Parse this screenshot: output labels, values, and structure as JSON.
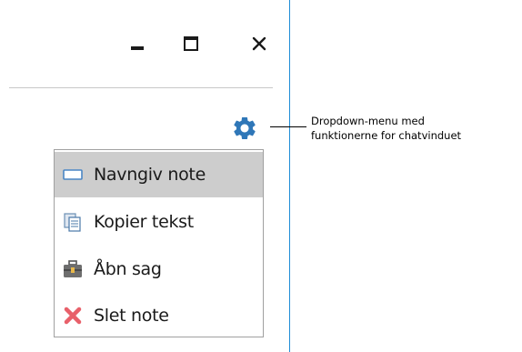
{
  "window_controls": {
    "minimize_icon": "minimize-icon",
    "maximize_icon": "maximize-icon",
    "close_icon": "close-icon"
  },
  "settings": {
    "icon": "gear-icon",
    "color": "#2f77b8"
  },
  "menu": {
    "items": [
      {
        "label": "Navngiv note",
        "icon": "rename-icon",
        "highlighted": true
      },
      {
        "label": "Kopier tekst",
        "icon": "copy-icon",
        "highlighted": false
      },
      {
        "label": "Åbn sag",
        "icon": "briefcase-icon",
        "highlighted": false
      },
      {
        "label": "Slet note",
        "icon": "delete-icon",
        "highlighted": false
      }
    ]
  },
  "annotation": {
    "line1": "Dropdown-menu med",
    "line2": "funktionerne for chatvinduet"
  },
  "colors": {
    "accent": "#1f8dd6",
    "highlight": "#cdcdcd",
    "delete": "#e8606a"
  }
}
